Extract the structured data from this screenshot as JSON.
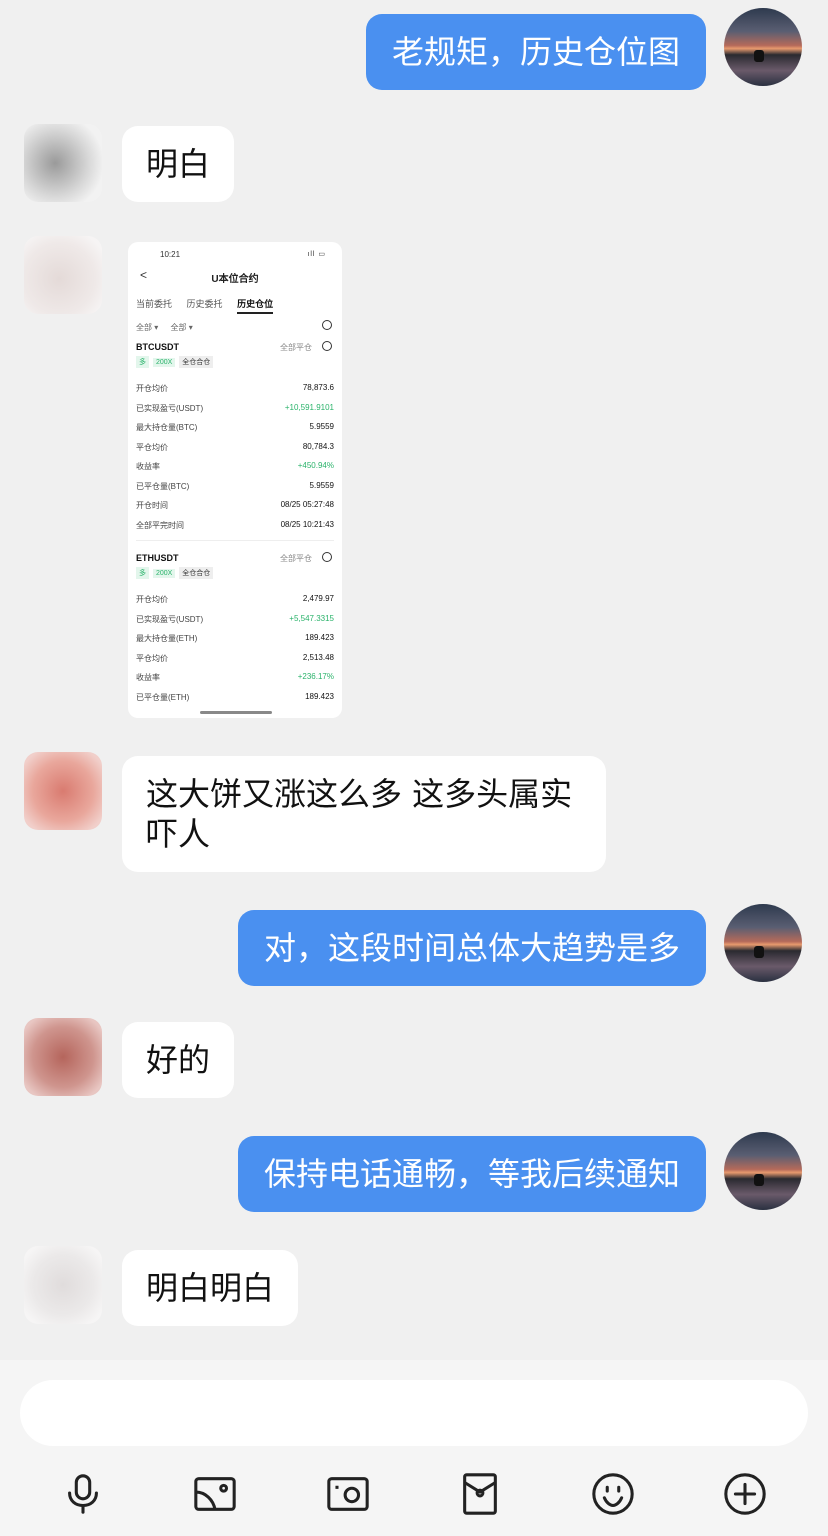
{
  "messages": [
    {
      "from": "me",
      "text": "老规矩，历史仓位图"
    },
    {
      "from": "them",
      "text": "明白"
    },
    {
      "from": "them",
      "type": "image"
    },
    {
      "from": "them",
      "text": "这大饼又涨这么多 这多头属实吓人"
    },
    {
      "from": "me",
      "text": "对，这段时间总体大趋势是多"
    },
    {
      "from": "them",
      "text": "好的"
    },
    {
      "from": "me",
      "text": "保持电话通畅，等我后续通知"
    },
    {
      "from": "them",
      "text": "明白明白"
    }
  ],
  "screenshot": {
    "time": "10:21",
    "status_icons": "ıll ▭",
    "back": "<",
    "title": "U本位合约",
    "tabs": [
      "当前委托",
      "历史委托",
      "历史仓位"
    ],
    "filters": [
      "全部 ▾",
      "全部 ▾"
    ],
    "positions": [
      {
        "symbol": "BTCUSDT",
        "close_all": "全部平仓",
        "tags": [
          "多",
          "200X",
          "全仓合仓"
        ],
        "rows": [
          {
            "label": "开仓均价",
            "value": "78,873.6"
          },
          {
            "label": "已实现盈亏(USDT)",
            "value": "+10,591.9101",
            "green": true
          },
          {
            "label": "最大持仓量(BTC)",
            "value": "5.9559"
          },
          {
            "label": "平仓均价",
            "value": "80,784.3"
          },
          {
            "label": "收益率",
            "value": "+450.94%",
            "green": true
          },
          {
            "label": "已平仓量(BTC)",
            "value": "5.9559"
          },
          {
            "label": "开仓时间",
            "value": "08/25 05:27:48"
          },
          {
            "label": "全部平完时间",
            "value": "08/25 10:21:43"
          }
        ]
      },
      {
        "symbol": "ETHUSDT",
        "close_all": "全部平仓",
        "tags": [
          "多",
          "200X",
          "全仓合仓"
        ],
        "rows": [
          {
            "label": "开仓均价",
            "value": "2,479.97"
          },
          {
            "label": "已实现盈亏(USDT)",
            "value": "+5,547.3315",
            "green": true
          },
          {
            "label": "最大持仓量(ETH)",
            "value": "189.423"
          },
          {
            "label": "平仓均价",
            "value": "2,513.48"
          },
          {
            "label": "收益率",
            "value": "+236.17%",
            "green": true
          },
          {
            "label": "已平仓量(ETH)",
            "value": "189.423"
          }
        ]
      }
    ]
  },
  "toolbar": {
    "icons": [
      "microphone-icon",
      "image-icon",
      "camera-icon",
      "red-packet-icon",
      "emoji-icon",
      "plus-icon"
    ]
  },
  "colors": {
    "my_bubble": "#4a90f0",
    "their_bubble": "#ffffff",
    "background": "#f0f0f0",
    "profit_green": "#2bb36b"
  }
}
